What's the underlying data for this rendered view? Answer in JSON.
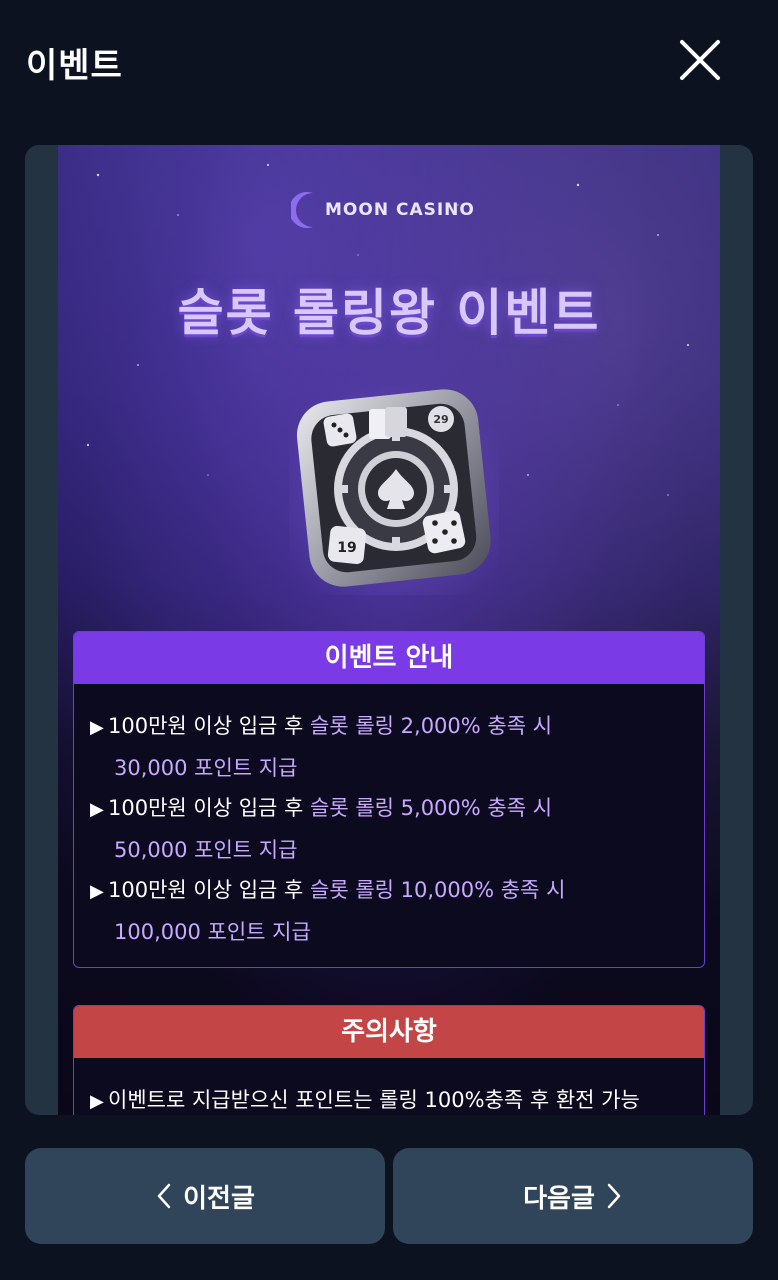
{
  "header": {
    "title": "이벤트",
    "close_icon": "close-icon"
  },
  "poster": {
    "logo_text": "MOON CASINO",
    "headline": "슬롯 롤링왕 이벤트",
    "emblem_icon": "casino-chip-emblem-icon",
    "emblem_dice_number": "19",
    "emblem_chip_number": "29",
    "info": {
      "title": "이벤트 안내",
      "items": [
        {
          "prefix": "100만원 이상 입금 후 ",
          "highlight": "슬롯 롤링 2,000% 충족 시",
          "reward": "30,000 포인트 지급"
        },
        {
          "prefix": "100만원 이상 입금 후 ",
          "highlight": "슬롯 롤링 5,000% 충족 시",
          "reward": "50,000 포인트 지급"
        },
        {
          "prefix": "100만원 이상 입금 후 ",
          "highlight": "슬롯 롤링 10,000% 충족 시",
          "reward": "100,000 포인트 지급"
        }
      ]
    },
    "notice": {
      "title": "주의사항",
      "line": "이벤트로 지급받으신 포인트는 롤링 100%충족 후 환전 가능"
    }
  },
  "footer": {
    "prev_label": "이전글",
    "next_label": "다음글"
  },
  "colors": {
    "background": "#0d1220",
    "button": "#30455a",
    "info_header": "#7a3be6",
    "notice_header": "#c44545",
    "highlight": "#c9a8ff"
  }
}
